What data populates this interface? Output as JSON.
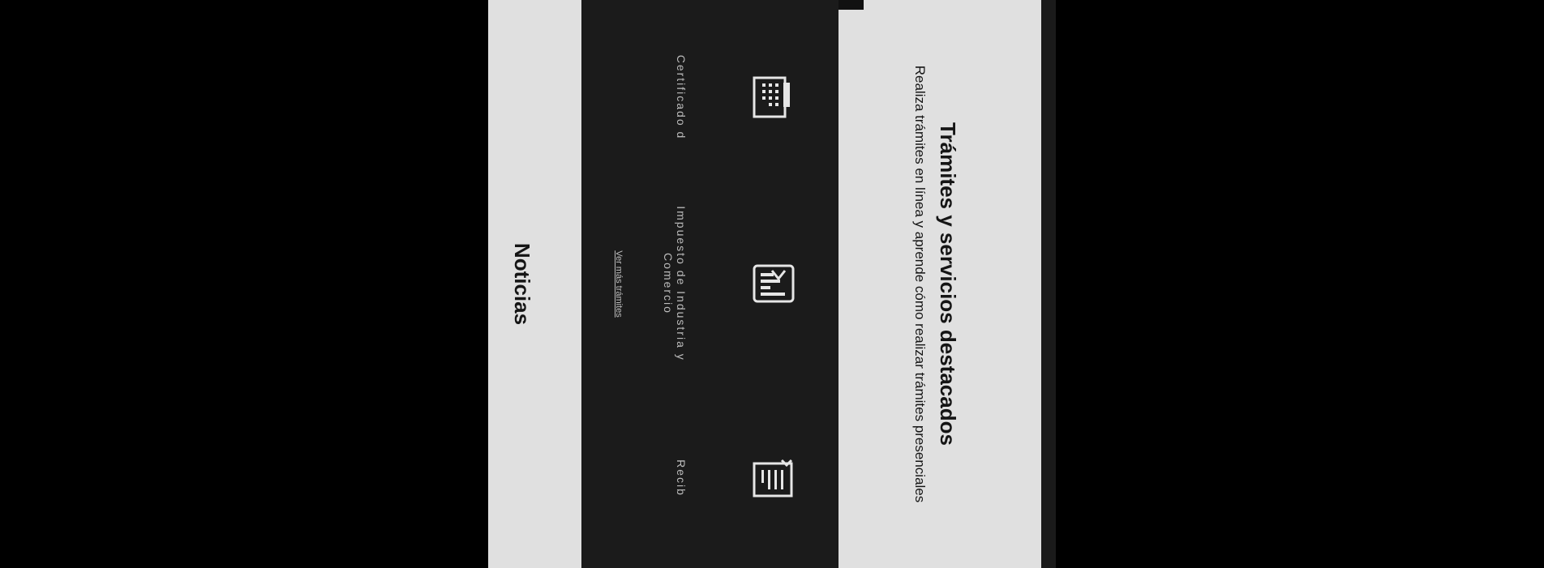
{
  "featured": {
    "title": "Trámites y servicios destacados",
    "subtitle": "Realiza trámites en línea y aprende cómo realizar trámites presenciales"
  },
  "tramites": {
    "items": [
      {
        "label": "Certificado d",
        "icon": "building-icon"
      },
      {
        "label": "Impuesto de Industria y Comercio",
        "icon": "document-chart-icon"
      },
      {
        "label": "Recib",
        "icon": "receipt-icon"
      }
    ],
    "all_link": "Ver más trámites"
  },
  "news": {
    "title": "Noticias"
  },
  "colors": {
    "background": "#000000",
    "light_section": "#e0e0e0",
    "dark_section": "#1b1b1b",
    "text_dark": "#151515",
    "text_light": "#bdbdbd"
  }
}
